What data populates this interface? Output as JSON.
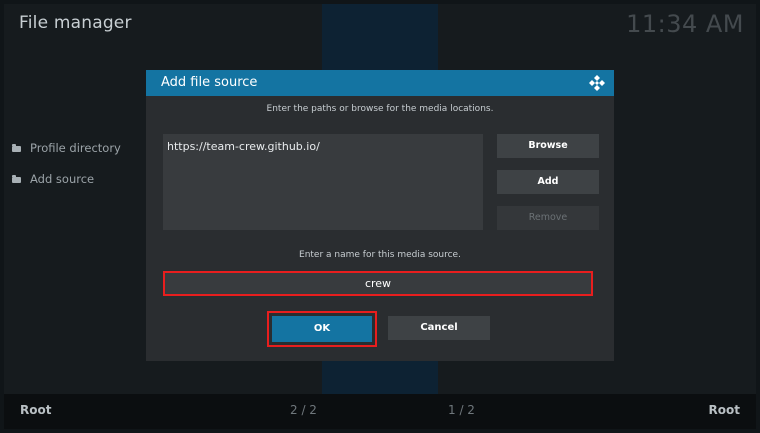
{
  "header": {
    "title": "File manager",
    "clock": "11:34 AM"
  },
  "sidebar": {
    "items": [
      {
        "label": "Profile directory",
        "icon": "folder-icon"
      },
      {
        "label": "Add source",
        "icon": "folder-icon"
      }
    ]
  },
  "footer": {
    "left": "Root",
    "left_page": "2 / 2",
    "right_page": "1 / 2",
    "right": "Root"
  },
  "dialog": {
    "title": "Add file source",
    "icon": "kodi-logo-icon",
    "instructions": "Enter the paths or browse for the media locations.",
    "paths": [
      "https://team-crew.github.io/"
    ],
    "buttons": {
      "browse": "Browse",
      "add": "Add",
      "remove": "Remove"
    },
    "name_label": "Enter a name for this media source.",
    "name_value": "crew",
    "ok": "OK",
    "cancel": "Cancel"
  },
  "colors": {
    "accent": "#1474a2",
    "highlight": "#e81e1e",
    "background": "#13181b"
  }
}
